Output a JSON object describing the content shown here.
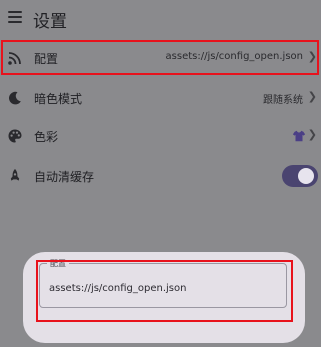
{
  "header": {
    "title": "设置",
    "menu_icon": "menu-icon"
  },
  "settings": {
    "config": {
      "label": "配置",
      "value": "assets://js/config_open.json",
      "icon": "rss-icon"
    },
    "dark_mode": {
      "label": "暗色模式",
      "value": "跟随系统",
      "icon": "moon-icon"
    },
    "color": {
      "label": "色彩",
      "icon": "palette-icon",
      "value_icon": "tshirt-icon"
    },
    "auto_clear_cache": {
      "label": "自动清缓存",
      "icon": "rocket-icon",
      "enabled": true
    }
  },
  "dialog": {
    "field_label": "配置",
    "field_value": "assets://js/config_open.json"
  },
  "colors": {
    "highlight": "#e8121c",
    "accent": "#4a4470",
    "shirt": "#4b3f86"
  }
}
